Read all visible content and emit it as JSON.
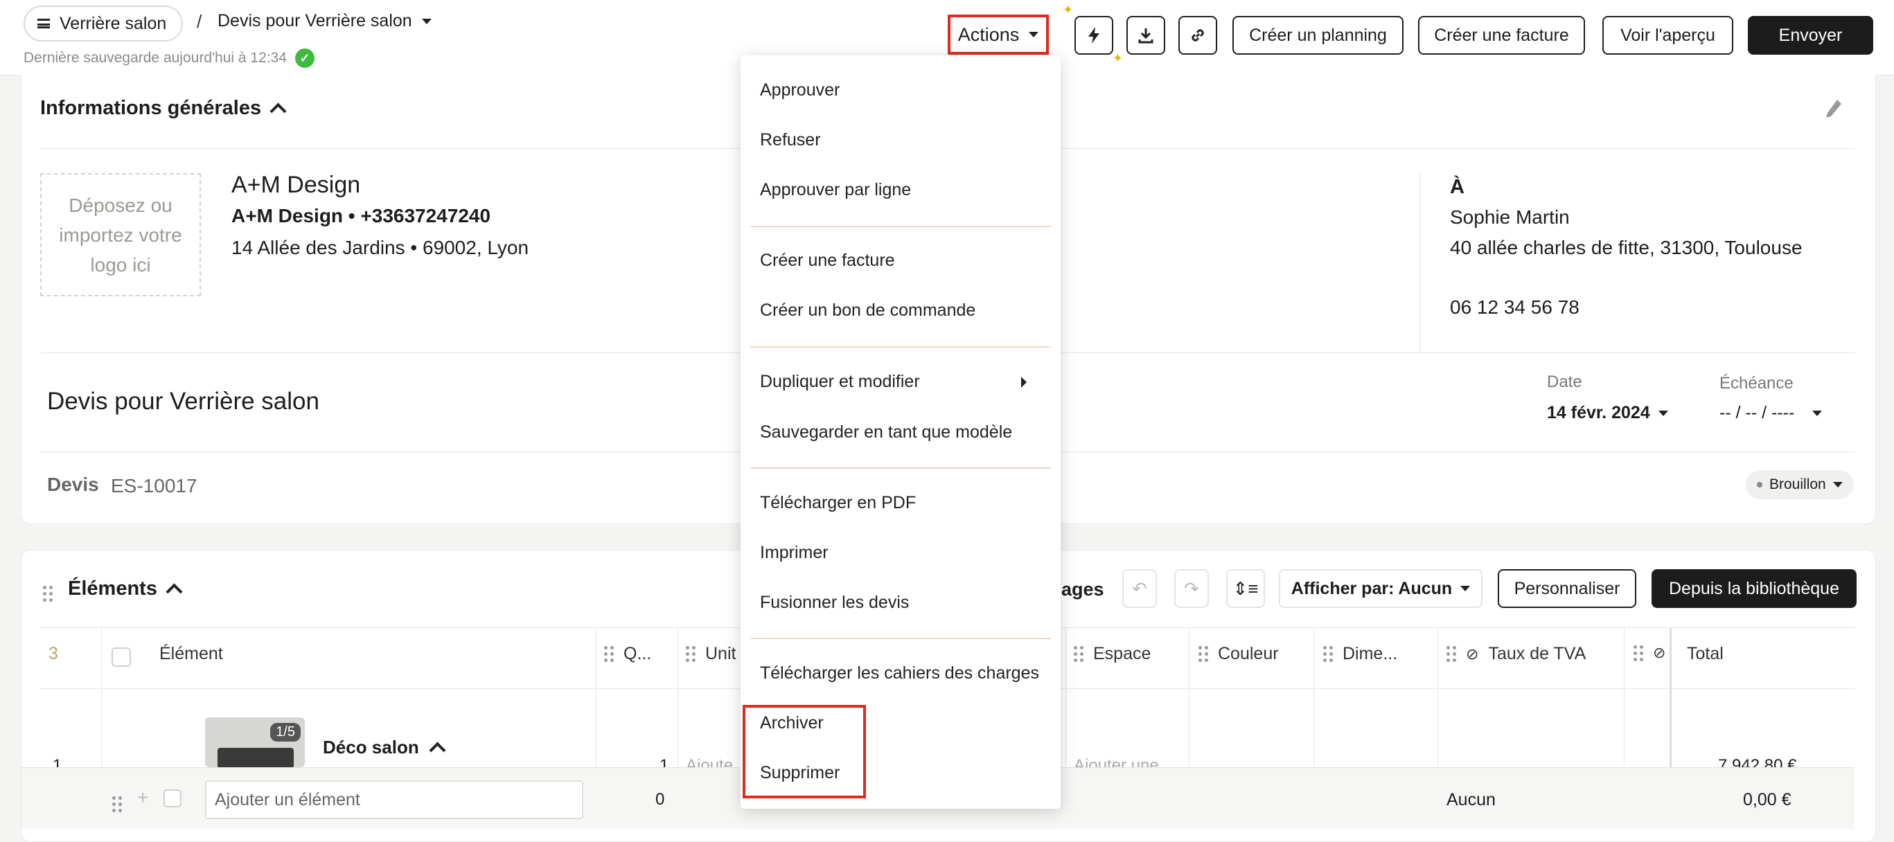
{
  "header": {
    "project_label": "Verrière salon",
    "separator": "/",
    "doc_title": "Devis pour Verrière salon",
    "saved_text": "Dernière sauvegarde aujourd'hui à 12:34",
    "actions_label": "Actions",
    "btn_planning": "Créer un planning",
    "btn_invoice": "Créer une facture",
    "btn_preview": "Voir l'aperçu",
    "btn_send": "Envoyer"
  },
  "general": {
    "title": "Informations générales",
    "logo_drop": "Déposez ou importez votre logo ici",
    "company_name": "A+M Design",
    "company_line2": "A+M Design  •  +33637247240",
    "company_line3": "14 Allée des Jardins  •  69002, Lyon",
    "to_label": "À",
    "client_name": "Sophie Martin",
    "client_address": "40 allée charles de fitte, 31300, Toulouse",
    "client_phone": "06 12 34 56 78",
    "quote_title": "Devis pour Verrière salon",
    "date_label": "Date",
    "date_value": "14 févr. 2024",
    "due_label": "Échéance",
    "due_value": "-- / -- / ----",
    "devis_label": "Devis",
    "devis_number": "ES-10017",
    "status": "Brouillon"
  },
  "elements": {
    "title": "Éléments",
    "partial_label": "ages",
    "display_by": "Afficher par: Aucun",
    "customize": "Personnaliser",
    "from_library": "Depuis la bibliothèque",
    "count": "3",
    "columns": [
      "Élément",
      "Q...",
      "Unit",
      "Espace",
      "Couleur",
      "Dime...",
      "Taux de TVA",
      "Total"
    ],
    "row1": {
      "num": "1",
      "image_counter": "1/5",
      "name": "Déco salon",
      "qty": "1",
      "partial_unit": "Ajoute",
      "partial_space": "Ajouter une",
      "total": "7 942,80 €"
    },
    "add_row": {
      "placeholder": "Ajouter un élément",
      "qty": "0",
      "vat": "Aucun",
      "total": "0,00 €"
    }
  },
  "menu": {
    "items": [
      "Approuver",
      "Refuser",
      "Approuver par ligne",
      "Créer une facture",
      "Créer un bon de commande",
      "Dupliquer et modifier",
      "Sauvegarder en tant que modèle",
      "Télécharger en PDF",
      "Imprimer",
      "Fusionner les devis",
      "Télécharger les cahiers des charges",
      "Archiver",
      "Supprimer"
    ]
  },
  "colors": {
    "accent_dark": "#1c1c1c",
    "highlight": "#e02a1e",
    "success": "#3dbb3d"
  }
}
